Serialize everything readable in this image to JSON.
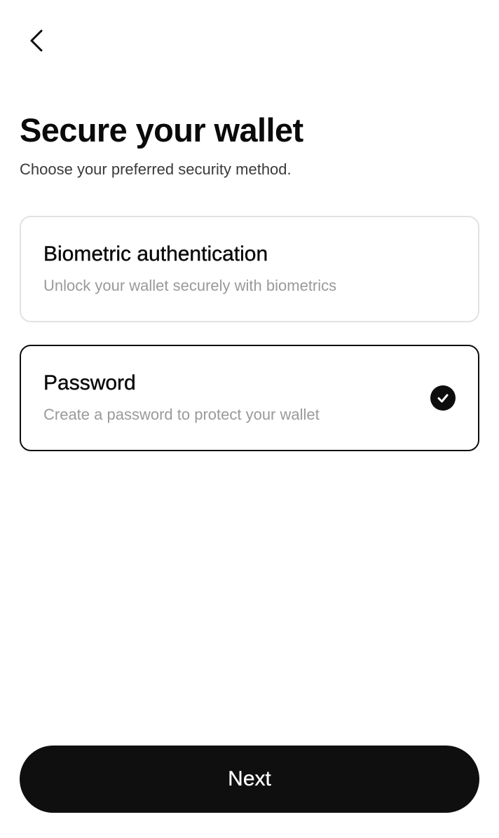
{
  "header": {
    "back_icon": "chevron-left-icon",
    "title": "Secure your wallet",
    "subtitle": "Choose your preferred security method."
  },
  "options": [
    {
      "title": "Biometric authentication",
      "description": "Unlock your wallet securely with biometrics",
      "selected": false
    },
    {
      "title": "Password",
      "description": "Create a password to protect your wallet",
      "selected": true,
      "selected_icon": "check-circle-icon"
    }
  ],
  "footer": {
    "next_label": "Next"
  },
  "colors": {
    "background": "#ffffff",
    "primary": "#0f0f0f",
    "border_unselected": "#e2e2e2",
    "secondary_text": "#9a9a9a"
  }
}
